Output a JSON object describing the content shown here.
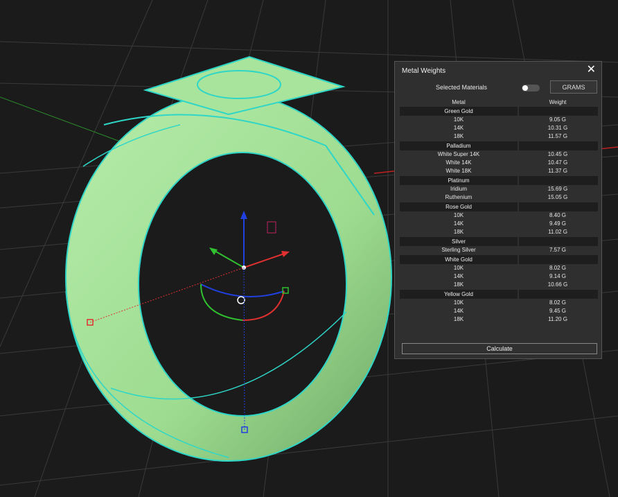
{
  "panel": {
    "title": "Metal Weights",
    "close_icon": "close-icon",
    "selected_materials_label": "Selected Materials",
    "toggle_state": "off",
    "units_button": "GRAMS",
    "col_metal": "Metal",
    "col_weight": "Weight",
    "calculate_label": "Calculate",
    "groups": [
      {
        "name": "Green Gold",
        "rows": [
          {
            "metal": "10K",
            "weight": "9.05 G"
          },
          {
            "metal": "14K",
            "weight": "10.31 G"
          },
          {
            "metal": "18K",
            "weight": "11.57 G"
          }
        ]
      },
      {
        "name": "Palladium",
        "rows": [
          {
            "metal": "White Super 14K",
            "weight": "10.45 G"
          },
          {
            "metal": "White 14K",
            "weight": "10.47 G"
          },
          {
            "metal": "White 18K",
            "weight": "11.37 G"
          }
        ]
      },
      {
        "name": "Platinum",
        "rows": [
          {
            "metal": "Iridium",
            "weight": "15.69 G"
          },
          {
            "metal": "Ruthenium",
            "weight": "15.05 G"
          }
        ]
      },
      {
        "name": "Rose Gold",
        "rows": [
          {
            "metal": "10K",
            "weight": "8.40 G"
          },
          {
            "metal": "14K",
            "weight": "9.49 G"
          },
          {
            "metal": "18K",
            "weight": "11.02 G"
          }
        ]
      },
      {
        "name": "Silver",
        "rows": [
          {
            "metal": "Sterling Silver",
            "weight": "7.57 G"
          }
        ]
      },
      {
        "name": "White Gold",
        "rows": [
          {
            "metal": "10K",
            "weight": "8.02 G"
          },
          {
            "metal": "14K",
            "weight": "9.14 G"
          },
          {
            "metal": "18K",
            "weight": "10.66 G"
          }
        ]
      },
      {
        "name": "Yellow Gold",
        "rows": [
          {
            "metal": "10K",
            "weight": "8.02 G"
          },
          {
            "metal": "14K",
            "weight": "9.45 G"
          },
          {
            "metal": "18K",
            "weight": "11.20 G"
          }
        ]
      }
    ]
  },
  "viewport": {
    "background": "#1a1a1a",
    "ring_fill": "#9fdf94",
    "wire_color": "#2ed6c8",
    "axis_x": "#e03030",
    "axis_y": "#30c030",
    "axis_z": "#2040e0"
  }
}
